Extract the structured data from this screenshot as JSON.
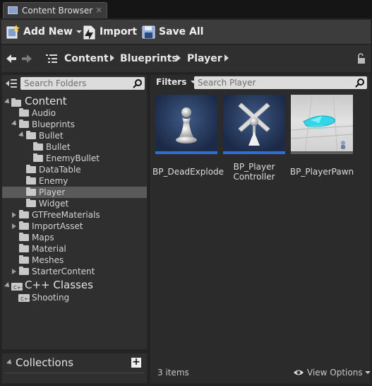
{
  "tab": {
    "title": "Content Browser",
    "close": "×"
  },
  "toolbar": {
    "add_new": "Add New",
    "import": "Import",
    "save_all": "Save All"
  },
  "path": {
    "crumbs": [
      "Content",
      "Blueprints",
      "Player"
    ]
  },
  "folders": {
    "search_placeholder": "Search Folders",
    "tree": [
      {
        "label": "Content"
      },
      {
        "label": "Audio"
      },
      {
        "label": "Blueprints"
      },
      {
        "label": "Bullet"
      },
      {
        "label": "Bullet"
      },
      {
        "label": "EnemyBullet"
      },
      {
        "label": "DataTable"
      },
      {
        "label": "Enemy"
      },
      {
        "label": "Player"
      },
      {
        "label": "Widget"
      },
      {
        "label": "GTFreeMaterials"
      },
      {
        "label": "ImportAsset"
      },
      {
        "label": "Maps"
      },
      {
        "label": "Material"
      },
      {
        "label": "Meshes"
      },
      {
        "label": "StarterContent"
      },
      {
        "label": "C++ Classes"
      },
      {
        "label": "Shooting"
      }
    ],
    "selected": "Player"
  },
  "collections": {
    "title": "Collections",
    "add": "+"
  },
  "assets": {
    "filters_label": "Filters",
    "search_placeholder": "Search Player",
    "items": [
      {
        "label": "BP_DeadExplode"
      },
      {
        "label": "BP_Player Controller"
      },
      {
        "label": "BP_PlayerPawn"
      }
    ],
    "count": "3 items",
    "view_options": "View Options"
  },
  "colors": {
    "accent": "#2d6fd6",
    "selection": "#5a5a5a",
    "panel": "#2f2f2f"
  }
}
